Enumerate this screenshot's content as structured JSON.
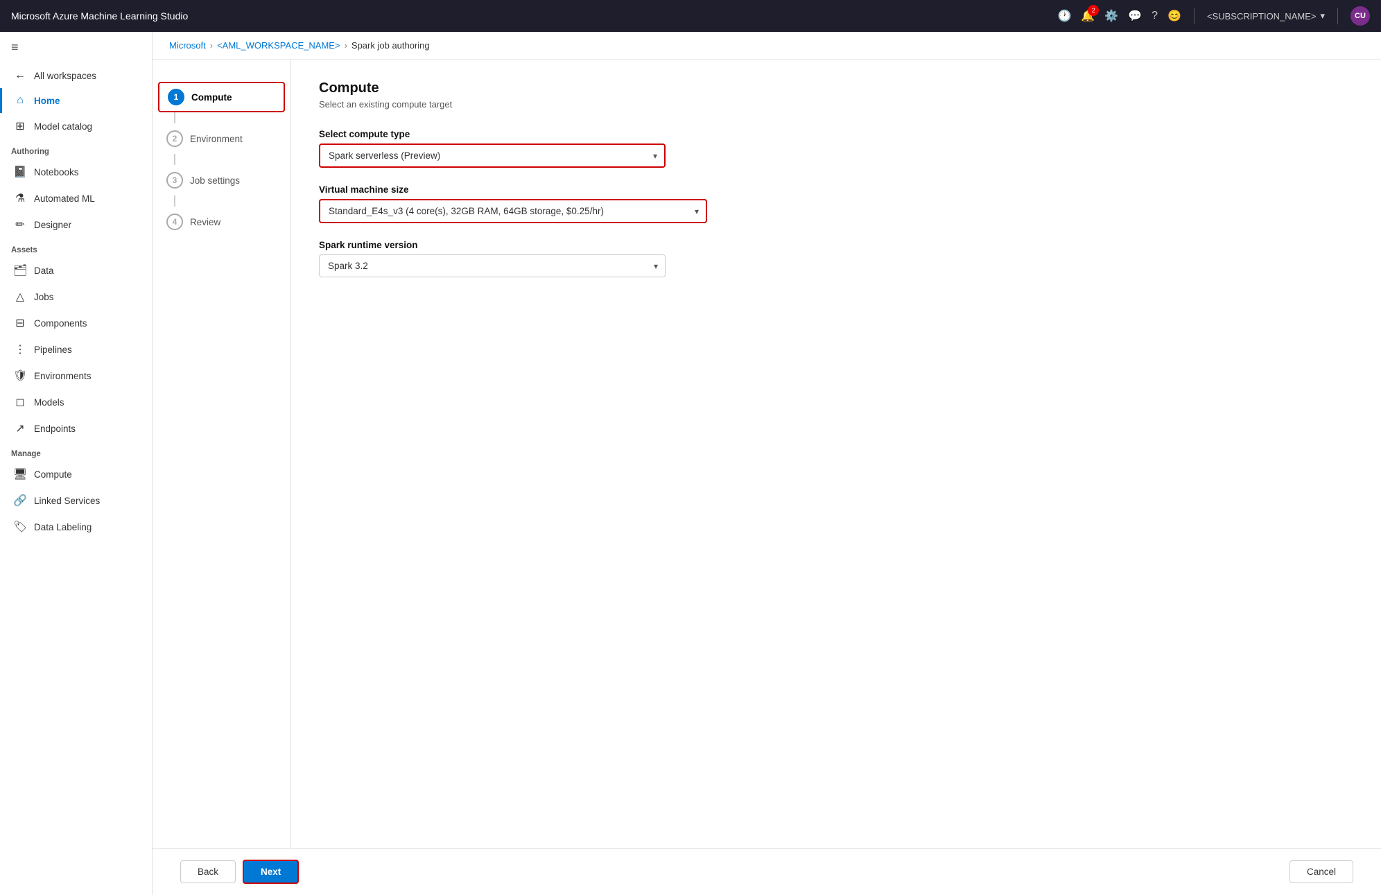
{
  "topbar": {
    "title": "Microsoft Azure Machine Learning Studio",
    "avatar_initials": "CU",
    "subscription": "<SUBSCRIPTION_NAME>",
    "notification_count": "2"
  },
  "breadcrumb": {
    "microsoft": "Microsoft",
    "workspace": "<AML_WORKSPACE_NAME>",
    "page": "Spark job authoring"
  },
  "sidebar": {
    "hamburger": "≡",
    "back_label": "All workspaces",
    "home_label": "Home",
    "model_catalog_label": "Model catalog",
    "authoring_section": "Authoring",
    "notebooks_label": "Notebooks",
    "automated_ml_label": "Automated ML",
    "designer_label": "Designer",
    "assets_section": "Assets",
    "data_label": "Data",
    "jobs_label": "Jobs",
    "components_label": "Components",
    "pipelines_label": "Pipelines",
    "environments_label": "Environments",
    "models_label": "Models",
    "endpoints_label": "Endpoints",
    "manage_section": "Manage",
    "compute_label": "Compute",
    "linked_services_label": "Linked Services",
    "data_labeling_label": "Data Labeling"
  },
  "wizard": {
    "steps": [
      {
        "number": "1",
        "label": "Compute",
        "active": true
      },
      {
        "number": "2",
        "label": "Environment"
      },
      {
        "number": "3",
        "label": "Job settings"
      },
      {
        "number": "4",
        "label": "Review"
      }
    ]
  },
  "form": {
    "title": "Compute",
    "subtitle": "Select an existing compute target",
    "compute_type_label": "Select compute type",
    "compute_type_value": "Spark serverless (Preview)",
    "vm_size_label": "Virtual machine size",
    "vm_size_value": "Standard_E4s_v3 (4 core(s), 32GB RAM, 64GB storage, $0.25/hr)",
    "spark_version_label": "Spark runtime version",
    "spark_version_value": "Spark 3.2"
  },
  "actions": {
    "back_label": "Back",
    "next_label": "Next",
    "cancel_label": "Cancel"
  }
}
